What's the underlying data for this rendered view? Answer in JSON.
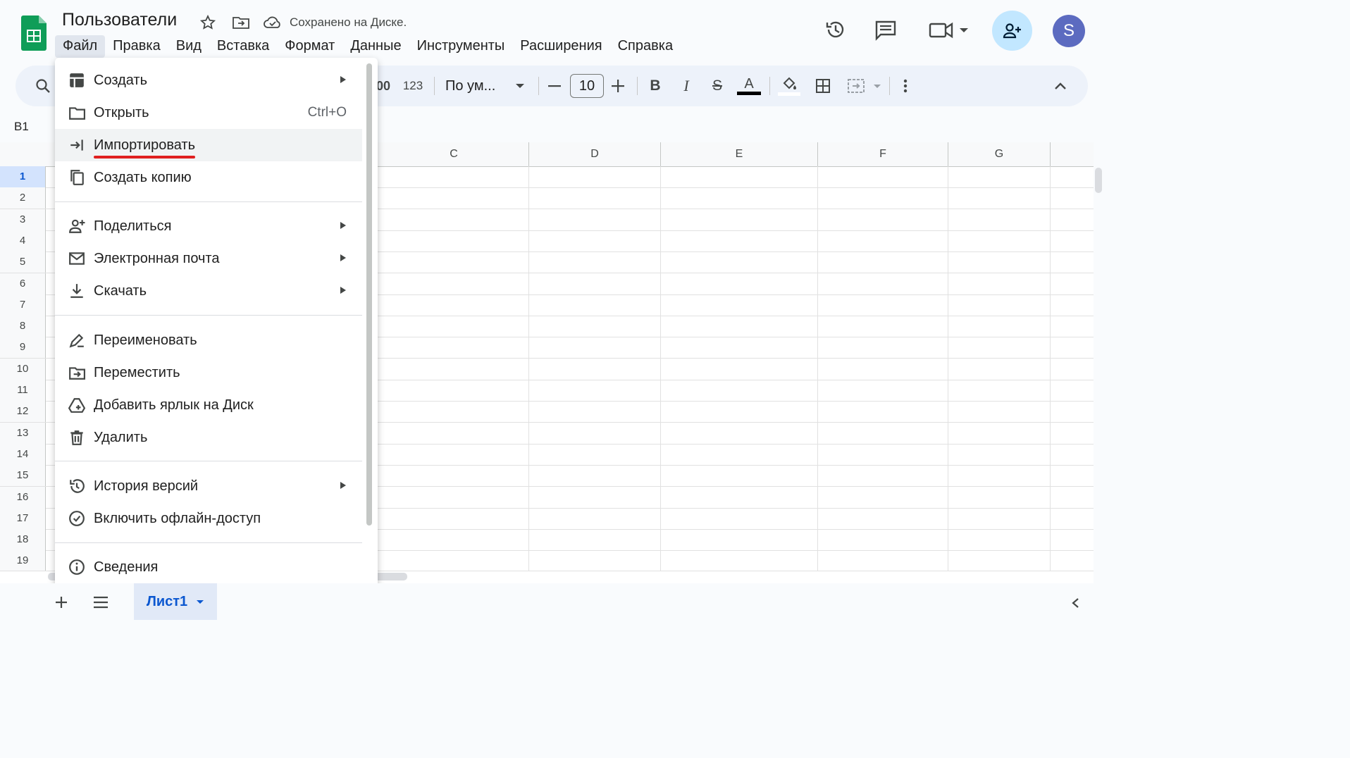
{
  "header": {
    "title": "Пользователи",
    "saved_status": "Сохранено на Диске.",
    "avatar_letter": "S"
  },
  "menubar": [
    "Файл",
    "Правка",
    "Вид",
    "Вставка",
    "Формат",
    "Данные",
    "Инструменты",
    "Расширения",
    "Справка"
  ],
  "toolbar": {
    "number_format": "123",
    "font": "По ум...",
    "font_size": "10"
  },
  "cell_reference": "B1",
  "columns": [
    "C",
    "D",
    "E",
    "F",
    "G"
  ],
  "rows": [
    "1",
    "2",
    "3",
    "4",
    "5",
    "6",
    "7",
    "8",
    "9",
    "10",
    "11",
    "12",
    "13",
    "14",
    "15",
    "16",
    "17",
    "18",
    "19"
  ],
  "file_menu": {
    "items": [
      {
        "label": "Создать",
        "icon": "create-table-icon",
        "submenu": true
      },
      {
        "label": "Открыть",
        "icon": "folder-icon",
        "shortcut": "Ctrl+O"
      },
      {
        "label": "Импортировать",
        "icon": "import-icon",
        "highlighted": true
      },
      {
        "label": "Создать копию",
        "icon": "copy-icon"
      },
      {
        "label": "Поделиться",
        "icon": "share-person-icon",
        "submenu": true
      },
      {
        "label": "Электронная почта",
        "icon": "mail-icon",
        "submenu": true
      },
      {
        "label": "Скачать",
        "icon": "download-icon",
        "submenu": true
      },
      {
        "label": "Переименовать",
        "icon": "rename-icon"
      },
      {
        "label": "Переместить",
        "icon": "move-folder-icon"
      },
      {
        "label": "Добавить ярлык на Диск",
        "icon": "drive-shortcut-icon"
      },
      {
        "label": "Удалить",
        "icon": "trash-icon"
      },
      {
        "label": "История версий",
        "icon": "history-icon",
        "submenu": true
      },
      {
        "label": "Включить офлайн-доступ",
        "icon": "offline-check-icon"
      },
      {
        "label": "Сведения",
        "icon": "info-icon"
      }
    ]
  },
  "sheet_tabs": [
    {
      "label": "Лист1",
      "active": true
    }
  ],
  "colors": {
    "accent": "#0b57d0",
    "sheets_green": "#0f9d58",
    "share_button": "#c2e7ff",
    "avatar_bg": "#5c6bc0",
    "import_underline": "#e02020"
  }
}
